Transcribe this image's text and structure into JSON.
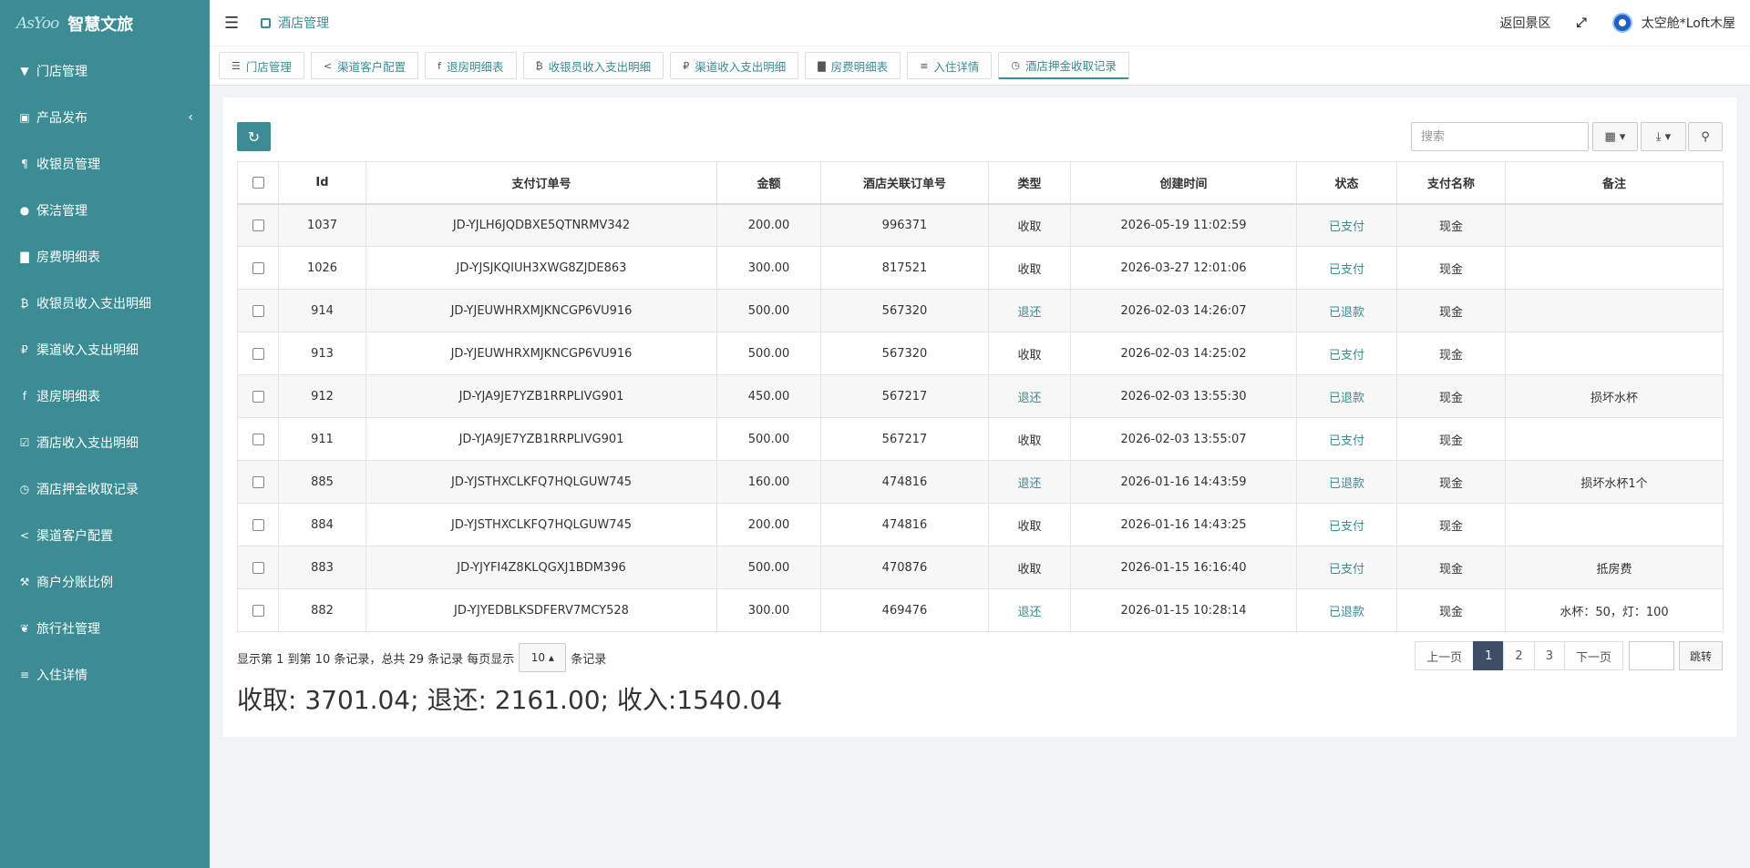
{
  "brand": {
    "logo": "AsYoo",
    "title": "智慧文旅"
  },
  "sidebar": {
    "items": [
      {
        "label": "门店管理",
        "icon": "filter-icon"
      },
      {
        "label": "产品发布",
        "icon": "square-icon"
      },
      {
        "label": "收银员管理",
        "icon": "paragraph-icon"
      },
      {
        "label": "保洁管理",
        "icon": "user-icon"
      },
      {
        "label": "房费明细表",
        "icon": "bar-chart-icon"
      },
      {
        "label": "收银员收入支出明细",
        "icon": "bitcoin-icon"
      },
      {
        "label": "渠道收入支出明细",
        "icon": "ruble-icon"
      },
      {
        "label": "退房明细表",
        "icon": "facebook-icon"
      },
      {
        "label": "酒店收入支出明细",
        "icon": "check-square-icon"
      },
      {
        "label": "酒店押金收取记录",
        "icon": "clock-icon"
      },
      {
        "label": "渠道客户配置",
        "icon": "share-icon"
      },
      {
        "label": "商户分账比例",
        "icon": "gavel-icon"
      },
      {
        "label": "旅行社管理",
        "icon": "baidu-icon"
      },
      {
        "label": "入住详情",
        "icon": "stack-icon"
      }
    ]
  },
  "header": {
    "current_tab": "酒店管理",
    "back_link": "返回景区",
    "user_name": "太空舱*Loft木屋"
  },
  "tabs": [
    {
      "label": "门店管理",
      "active": false
    },
    {
      "label": "渠道客户配置",
      "active": false
    },
    {
      "label": "退房明细表",
      "active": false
    },
    {
      "label": "收银员收入支出明细",
      "active": false
    },
    {
      "label": "渠道收入支出明细",
      "active": false
    },
    {
      "label": "房费明细表",
      "active": false
    },
    {
      "label": "入住详情",
      "active": false
    },
    {
      "label": "酒店押金收取记录",
      "active": true
    }
  ],
  "toolbar": {
    "search_placeholder": "搜索"
  },
  "table": {
    "columns": [
      "Id",
      "支付订单号",
      "金额",
      "酒店关联订单号",
      "类型",
      "创建时间",
      "状态",
      "支付名称",
      "备注"
    ],
    "rows": [
      {
        "id": "1037",
        "order": "JD-YJLH6JQDBXE5QTNRMV342",
        "amount": "200.00",
        "hotel_order": "996371",
        "type": "收取",
        "time": "2026-05-19 11:02:59",
        "status": "已支付",
        "pay": "现金",
        "note": ""
      },
      {
        "id": "1026",
        "order": "JD-YJSJKQIUH3XWG8ZJDE863",
        "amount": "300.00",
        "hotel_order": "817521",
        "type": "收取",
        "time": "2026-03-27 12:01:06",
        "status": "已支付",
        "pay": "现金",
        "note": ""
      },
      {
        "id": "914",
        "order": "JD-YJEUWHRXMJKNCGP6VU916",
        "amount": "500.00",
        "hotel_order": "567320",
        "type": "退还",
        "time": "2026-02-03 14:26:07",
        "status": "已退款",
        "pay": "现金",
        "note": ""
      },
      {
        "id": "913",
        "order": "JD-YJEUWHRXMJKNCGP6VU916",
        "amount": "500.00",
        "hotel_order": "567320",
        "type": "收取",
        "time": "2026-02-03 14:25:02",
        "status": "已支付",
        "pay": "现金",
        "note": ""
      },
      {
        "id": "912",
        "order": "JD-YJA9JE7YZB1RRPLIVG901",
        "amount": "450.00",
        "hotel_order": "567217",
        "type": "退还",
        "time": "2026-02-03 13:55:30",
        "status": "已退款",
        "pay": "现金",
        "note": "损坏水杯"
      },
      {
        "id": "911",
        "order": "JD-YJA9JE7YZB1RRPLIVG901",
        "amount": "500.00",
        "hotel_order": "567217",
        "type": "收取",
        "time": "2026-02-03 13:55:07",
        "status": "已支付",
        "pay": "现金",
        "note": ""
      },
      {
        "id": "885",
        "order": "JD-YJSTHXCLKFQ7HQLGUW745",
        "amount": "160.00",
        "hotel_order": "474816",
        "type": "退还",
        "time": "2026-01-16 14:43:59",
        "status": "已退款",
        "pay": "现金",
        "note": "损坏水杯1个"
      },
      {
        "id": "884",
        "order": "JD-YJSTHXCLKFQ7HQLGUW745",
        "amount": "200.00",
        "hotel_order": "474816",
        "type": "收取",
        "time": "2026-01-16 14:43:25",
        "status": "已支付",
        "pay": "现金",
        "note": ""
      },
      {
        "id": "883",
        "order": "JD-YJYFI4Z8KLQGXJ1BDM396",
        "amount": "500.00",
        "hotel_order": "470876",
        "type": "收取",
        "time": "2026-01-15 16:16:40",
        "status": "已支付",
        "pay": "现金",
        "note": "抵房费"
      },
      {
        "id": "882",
        "order": "JD-YJYEDBLKSDFERV7MCY528",
        "amount": "300.00",
        "hotel_order": "469476",
        "type": "退还",
        "time": "2026-01-15 10:28:14",
        "status": "已退款",
        "pay": "现金",
        "note": "水杯：50，灯：100"
      }
    ]
  },
  "pager": {
    "info_prefix": "显示第 1 到第 10 条记录，总共 29 条记录 每页显示",
    "page_size": "10",
    "info_suffix": "条记录",
    "prev": "上一页",
    "pages": [
      "1",
      "2",
      "3"
    ],
    "current_page": "1",
    "next": "下一页",
    "jump": "跳转"
  },
  "summary": "收取: 3701.04; 退还: 2161.00; 收入:1540.04",
  "colors": {
    "sidebar": "#3b8c94",
    "accent": "#3b8c94",
    "pager_active": "#3f4d66"
  }
}
